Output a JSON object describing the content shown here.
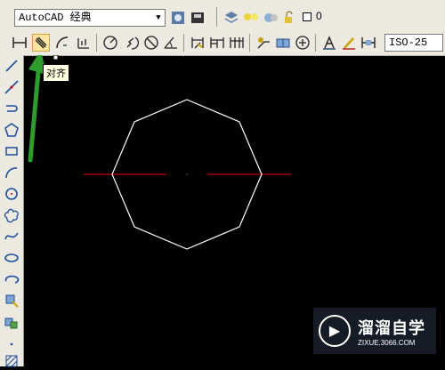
{
  "workspace": {
    "value": "AutoCAD 经典"
  },
  "layer": {
    "value": "0"
  },
  "dimstyle": {
    "value": "ISO-25"
  },
  "tooltip": {
    "text": "对齐"
  },
  "watermark": {
    "brand": "溜溜自学",
    "url": "ZIXUE.3066.COM"
  },
  "drawing": {
    "shape": "octagon",
    "line_color": "#ffffff",
    "centerline_color": "#c00000"
  },
  "colors": {
    "toolbar_bg": "#ece9e0",
    "canvas_bg": "#000000",
    "arrow": "#2e9d2e"
  }
}
